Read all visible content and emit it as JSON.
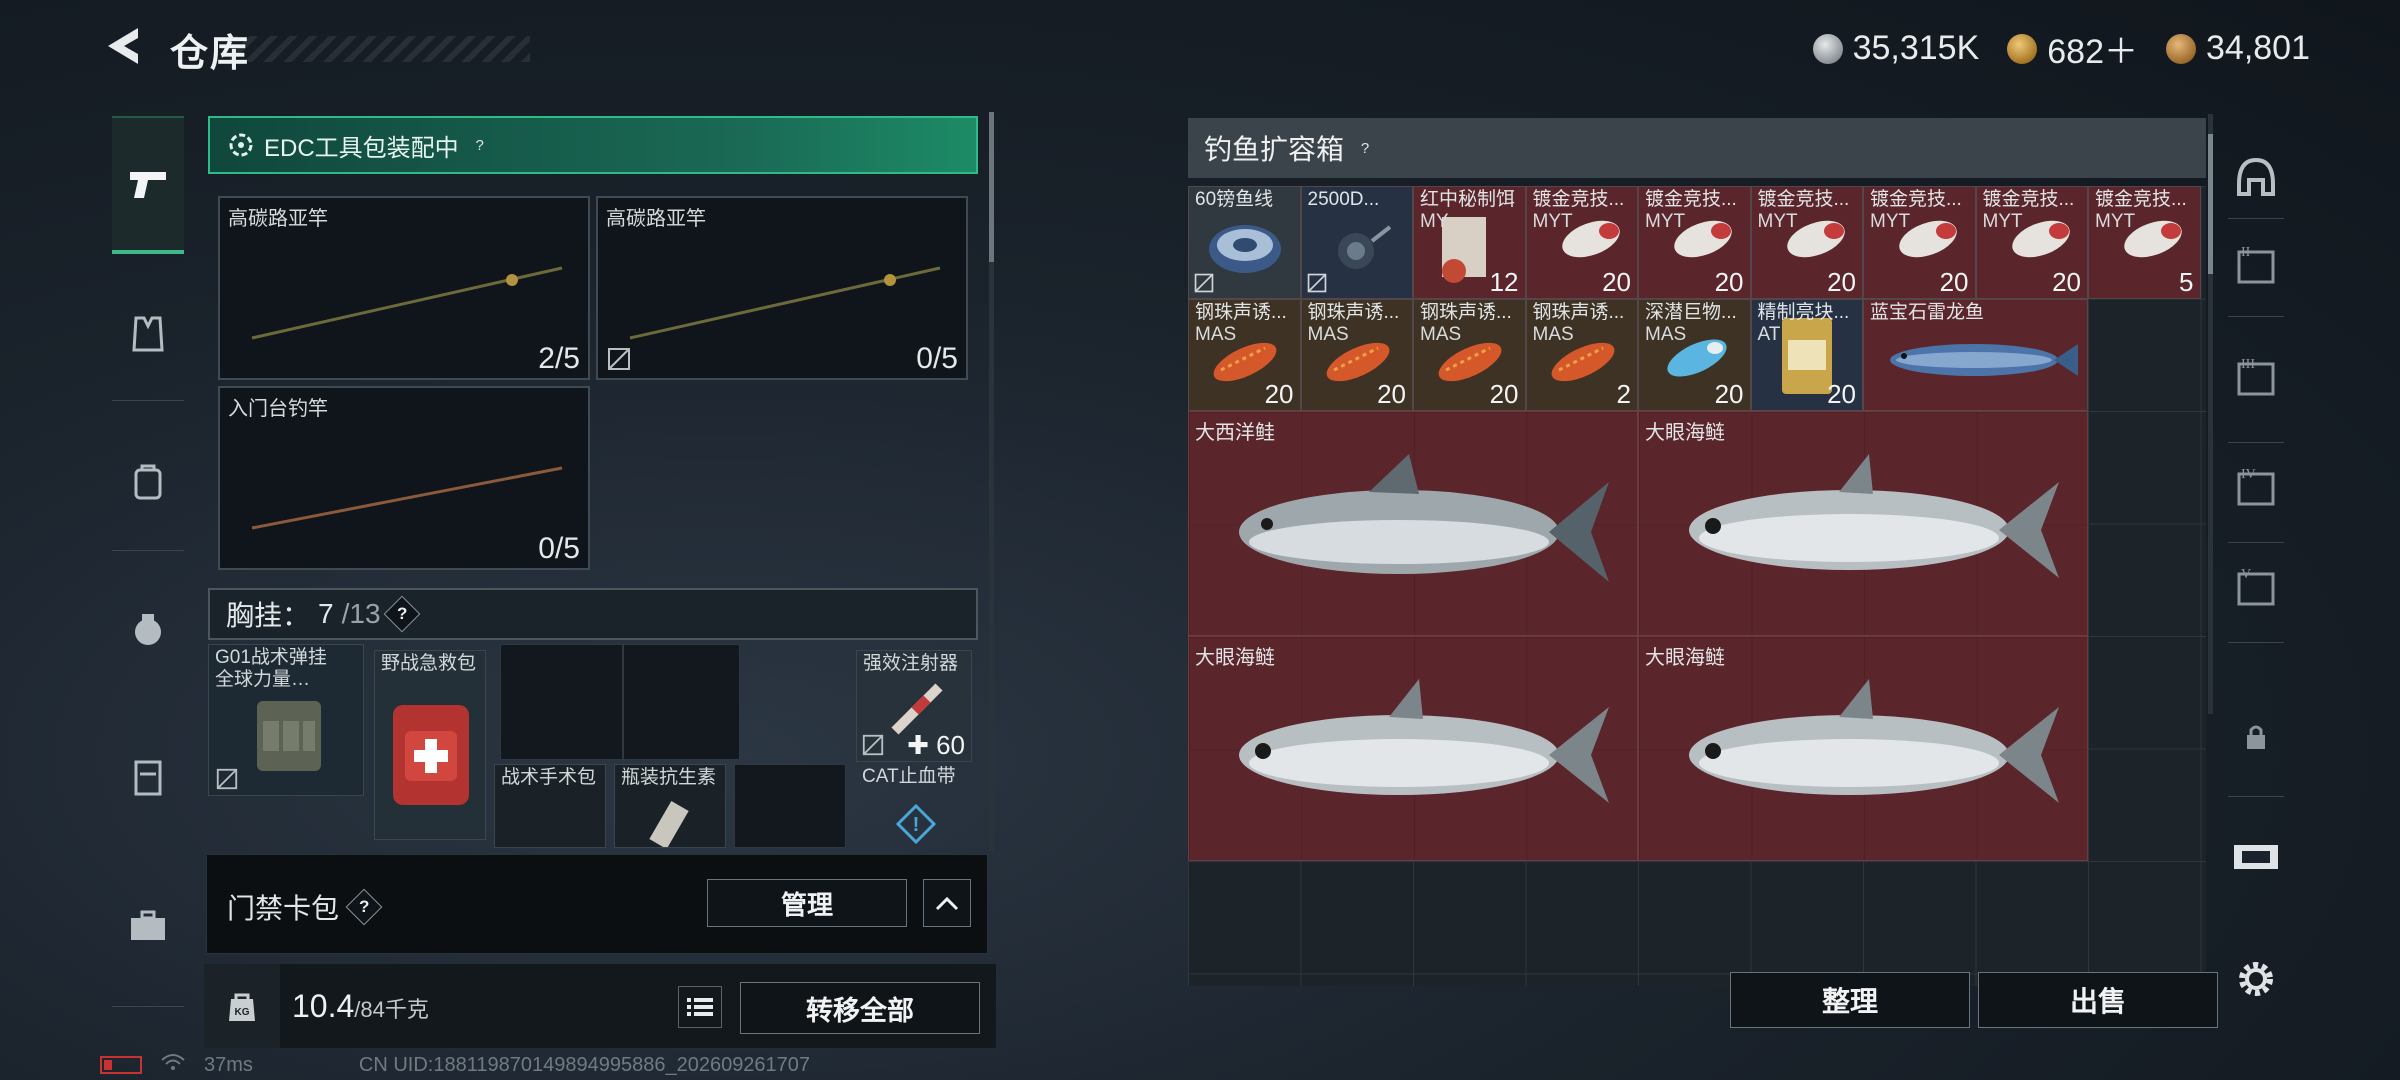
{
  "header": {
    "title": "仓库",
    "currencies": [
      {
        "icon": "silver-coin-icon",
        "value": "35,315K",
        "color": "#aeb3b6"
      },
      {
        "icon": "gold-triangle-coin-icon",
        "value": "682＋",
        "color": "#c99a46"
      },
      {
        "icon": "bronze-coin-icon",
        "value": "34,801",
        "color": "#b8874a"
      }
    ]
  },
  "left_nav": {
    "items": [
      "pistol-icon",
      "armor-vest-icon",
      "backpack-icon",
      "rig-icon",
      "case-icon",
      "toolbox-icon"
    ]
  },
  "loadout": {
    "edc_label": "EDC工具包装配中",
    "rods": [
      {
        "name": "高碳路亚竿",
        "count": "2/5",
        "locked": false
      },
      {
        "name": "高碳路亚竿",
        "count": "0/5",
        "locked": true
      },
      {
        "name": "入门台钓竿",
        "count": "0/5",
        "locked": false
      }
    ],
    "chest": {
      "label": "胸挂：",
      "used": "7",
      "total": "/13"
    },
    "chest_items": [
      {
        "name": "G01战术弹挂",
        "sub": "全球力量…"
      },
      {
        "name": "野战急救包"
      },
      {
        "name": "强效注射器",
        "count": "60"
      },
      {
        "name": "战术手术包"
      },
      {
        "name": "瓶装抗生素"
      },
      {
        "name": "CAT止血带"
      }
    ],
    "card_bag": {
      "label": "门禁卡包",
      "manage": "管理"
    },
    "weight": {
      "value": "10.4",
      "max": "/84",
      "unit": "千克"
    },
    "transfer_all": "转移全部"
  },
  "status_bar": {
    "ping": "37ms",
    "uid": "CN UID:188119870149894995886_202609261707"
  },
  "container": {
    "title": "钓鱼扩容箱",
    "items": [
      {
        "name": "60镑鱼线",
        "sub": "",
        "count": "",
        "locked": true
      },
      {
        "name": "2500D...",
        "sub": "",
        "count": "",
        "locked": true
      },
      {
        "name": "红中秘制饵",
        "sub": "MY",
        "count": "12",
        "locked": false
      },
      {
        "name": "镀金竞技...",
        "sub": "MYT",
        "count": "20",
        "locked": false
      },
      {
        "name": "镀金竞技...",
        "sub": "MYT",
        "count": "20",
        "locked": false
      },
      {
        "name": "镀金竞技...",
        "sub": "MYT",
        "count": "20",
        "locked": false
      },
      {
        "name": "镀金竞技...",
        "sub": "MYT",
        "count": "20",
        "locked": false
      },
      {
        "name": "镀金竞技...",
        "sub": "MYT",
        "count": "20",
        "locked": false
      },
      {
        "name": "镀金竞技...",
        "sub": "MYT",
        "count": "5",
        "locked": false
      },
      {
        "name": "钢珠声诱...",
        "sub": "MAS",
        "count": "20",
        "locked": false
      },
      {
        "name": "钢珠声诱...",
        "sub": "MAS",
        "count": "20",
        "locked": false
      },
      {
        "name": "钢珠声诱...",
        "sub": "MAS",
        "count": "20",
        "locked": false
      },
      {
        "name": "钢珠声诱...",
        "sub": "MAS",
        "count": "2",
        "locked": false
      },
      {
        "name": "深潜巨物...",
        "sub": "MAS",
        "count": "20",
        "locked": false
      },
      {
        "name": "精制亮块...",
        "sub": "AT",
        "count": "20",
        "locked": false
      },
      {
        "name": "蓝宝石雷龙鱼",
        "sub": "",
        "count": "",
        "locked": false
      }
    ],
    "fish": [
      {
        "name": "大西洋鲑"
      },
      {
        "name": "大眼海鲢"
      },
      {
        "name": "大眼海鲢"
      },
      {
        "name": "大眼海鲢"
      }
    ],
    "sort": "整理",
    "sell": "出售"
  },
  "right_nav": {
    "items": [
      "helmet-icon",
      "slot-ii-icon",
      "slot-iii-icon",
      "slot-iv-icon",
      "slot-v-icon",
      "lock-icon",
      "expand-icon",
      "settings-icon"
    ]
  },
  "colors": {
    "accent": "#2fbb86",
    "item_red": "#5a262b",
    "panel": "#1c2329"
  }
}
